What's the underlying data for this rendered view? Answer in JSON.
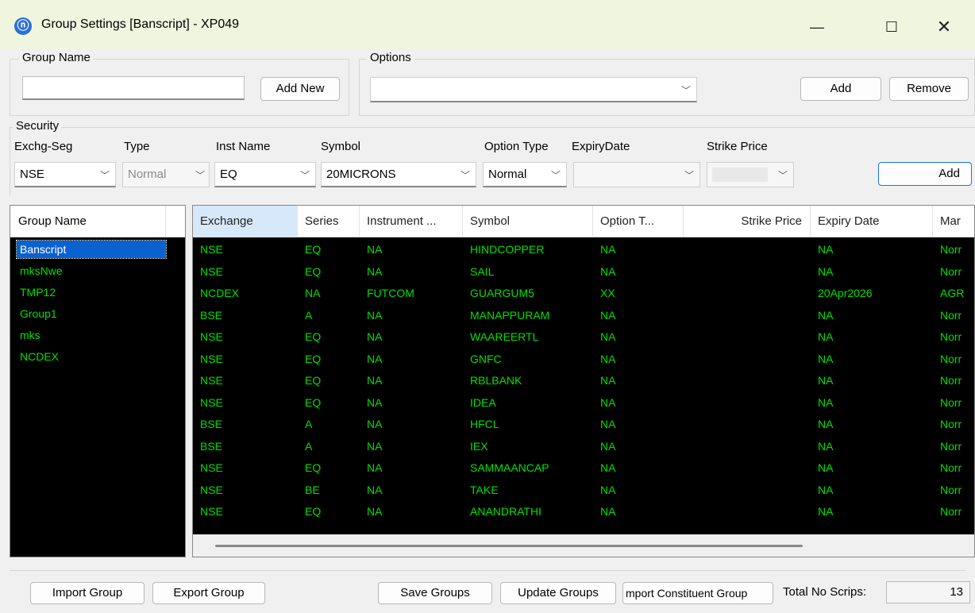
{
  "window": {
    "title": "Group Settings [Banscript] - XP049",
    "min_glyph": "—",
    "max_glyph": "☐",
    "close_glyph": "✕"
  },
  "group_name_box": {
    "legend": "Group Name",
    "input_value": "",
    "add_new_label": "Add New"
  },
  "options_box": {
    "legend": "Options",
    "selected": "",
    "add_label": "Add",
    "remove_label": "Remove"
  },
  "security_box": {
    "legend": "Security",
    "labels": {
      "exchg_seg": "Exchg-Seg",
      "type": "Type",
      "inst_name": "Inst Name",
      "symbol": "Symbol",
      "option_type": "Option Type",
      "expiry_date": "ExpiryDate",
      "strike_price": "Strike Price"
    },
    "values": {
      "exchg_seg": "NSE",
      "type": "Normal",
      "inst_name": "EQ",
      "symbol": "20MICRONS",
      "option_type": "Normal",
      "expiry_date": "",
      "strike_price": ""
    },
    "add_label": "Add"
  },
  "group_list": {
    "header": "Group Name",
    "items": [
      "Banscript",
      "mksNwe",
      "TMP12",
      "Group1",
      "mks",
      "NCDEX"
    ],
    "selected_index": 0
  },
  "grid": {
    "columns": [
      "Exchange",
      "Series",
      "Instrument ...",
      "Symbol",
      "Option T...",
      "Strike Price",
      "Expiry Date",
      "Mar"
    ],
    "rows": [
      [
        "NSE",
        "EQ",
        "NA",
        "HINDCOPPER",
        "NA",
        "",
        "NA",
        "Norr"
      ],
      [
        "NSE",
        "EQ",
        "NA",
        "SAIL",
        "NA",
        "",
        "NA",
        "Norr"
      ],
      [
        "NCDEX",
        "NA",
        "FUTCOM",
        "GUARGUM5",
        "XX",
        "",
        "20Apr2026",
        "AGR"
      ],
      [
        "BSE",
        "A",
        "NA",
        "MANAPPURAM",
        "NA",
        "",
        "NA",
        "Norr"
      ],
      [
        "NSE",
        "EQ",
        "NA",
        "WAAREERTL",
        "NA",
        "",
        "NA",
        "Norr"
      ],
      [
        "NSE",
        "EQ",
        "NA",
        "GNFC",
        "NA",
        "",
        "NA",
        "Norr"
      ],
      [
        "NSE",
        "EQ",
        "NA",
        "RBLBANK",
        "NA",
        "",
        "NA",
        "Norr"
      ],
      [
        "NSE",
        "EQ",
        "NA",
        "IDEA",
        "NA",
        "",
        "NA",
        "Norr"
      ],
      [
        "BSE",
        "A",
        "NA",
        "HFCL",
        "NA",
        "",
        "NA",
        "Norr"
      ],
      [
        "BSE",
        "A",
        "NA",
        "IEX",
        "NA",
        "",
        "NA",
        "Norr"
      ],
      [
        "NSE",
        "EQ",
        "NA",
        "SAMMAANCAP",
        "NA",
        "",
        "NA",
        "Norr"
      ],
      [
        "NSE",
        "BE",
        "NA",
        "TAKE",
        "NA",
        "",
        "NA",
        "Norr"
      ],
      [
        "NSE",
        "EQ",
        "NA",
        "ANANDRATHI",
        "NA",
        "",
        "NA",
        "Norr"
      ]
    ]
  },
  "bottom": {
    "import_group": "Import Group",
    "export_group": "Export Group",
    "save_groups": "Save Groups",
    "update_groups": "Update Groups",
    "import_constituent": "mport Constituent Group",
    "total_label": "Total No Scrips:",
    "total_value": "13"
  },
  "colors": {
    "grid_text": "#00e000",
    "grid_bg": "#000000",
    "selection": "#0a62d1",
    "titlebar": "#f0f5e0"
  }
}
